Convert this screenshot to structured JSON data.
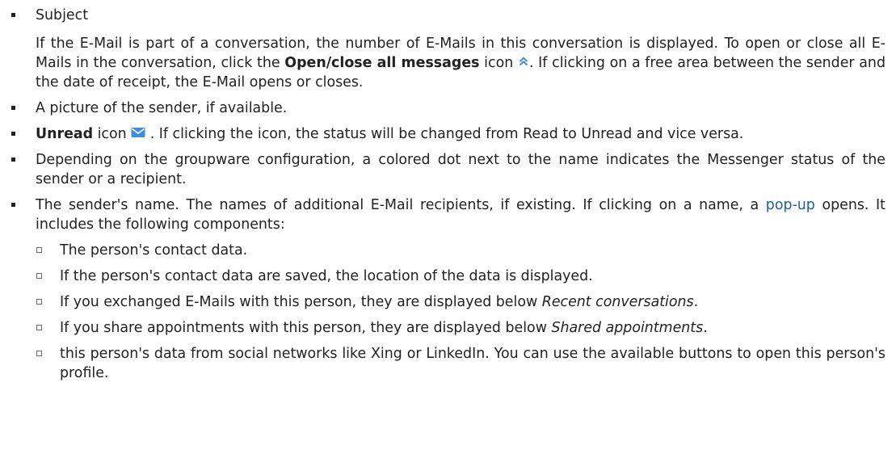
{
  "items": {
    "subject": {
      "label": "Subject",
      "para_a": "If the E-Mail is part of a conversation, the number of E-Mails in this conversation is displayed. To open or close all E-Mails in the conversation, click the ",
      "para_bold": "Open/close all messages",
      "para_b": " icon",
      "para_c": ". If clicking on a free area between the sender and the date of receipt, the E-Mail opens or closes."
    },
    "picture": {
      "text": "A picture of the sender, if available."
    },
    "unread": {
      "bold": "Unread",
      "text_a": " icon",
      "text_b": ". If clicking the icon, the status will be changed from Read to Unread and vice versa."
    },
    "dot": {
      "text": "Depending on the groupware configuration, a colored dot next to the name indicates the Mes­senger status of the sender or a recipient."
    },
    "names": {
      "text_a": "The sender's name. The names of additional E-Mail recipients, if existing. If clicking on a name, a ",
      "link": "pop-up",
      "text_b": " opens. It includes the following components:",
      "sub": {
        "contact": "The person's contact data.",
        "location": "If the person's contact data are saved, the location of the data is displayed.",
        "recent_a": "If you exchanged E-Mails with this person, they are displayed below ",
        "recent_em": "Recent conversations",
        "recent_b": ".",
        "shared_a": "If you share appointments with this person, they are displayed below ",
        "shared_em": "Shared appointments",
        "shared_b": ".",
        "social": "this person's data from social networks like Xing or LinkedIn. You can use the available buttons to open this person's profile."
      }
    }
  },
  "icons": {
    "open_close": "double-chevron-up-icon",
    "unread": "envelope-icon"
  },
  "colors": {
    "icon_blue": "#3d8fd8",
    "link": "#1f5fa8"
  }
}
